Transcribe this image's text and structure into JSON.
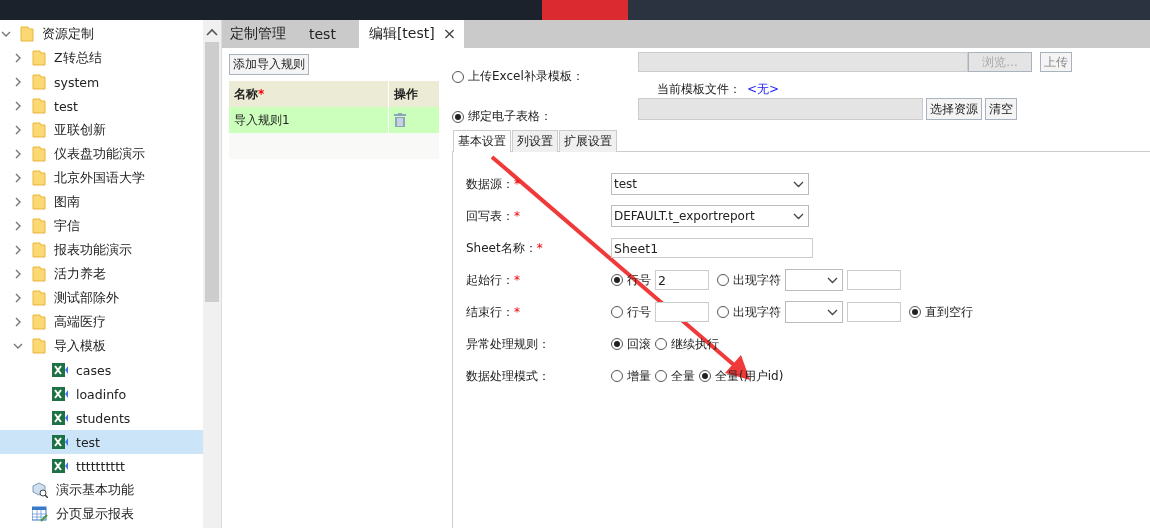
{
  "tree": [
    {
      "label": "资源定制",
      "kind": "folder",
      "expanded": true,
      "selected": false,
      "children": [
        {
          "label": "Z转总结",
          "kind": "folder",
          "expanded": false,
          "selected": false
        },
        {
          "label": "system",
          "kind": "folder",
          "expanded": false,
          "selected": false
        },
        {
          "label": "test",
          "kind": "folder",
          "expanded": false,
          "selected": false
        },
        {
          "label": "亚联创新",
          "kind": "folder",
          "expanded": false,
          "selected": false
        },
        {
          "label": "仪表盘功能演示",
          "kind": "folder",
          "expanded": false,
          "selected": false
        },
        {
          "label": "北京外国语大学",
          "kind": "folder",
          "expanded": false,
          "selected": false
        },
        {
          "label": "图南",
          "kind": "folder",
          "expanded": false,
          "selected": false
        },
        {
          "label": "宇信",
          "kind": "folder",
          "expanded": false,
          "selected": false
        },
        {
          "label": "报表功能演示",
          "kind": "folder",
          "expanded": false,
          "selected": false
        },
        {
          "label": "活力养老",
          "kind": "folder",
          "expanded": false,
          "selected": false
        },
        {
          "label": "测试部除外",
          "kind": "folder",
          "expanded": false,
          "selected": false
        },
        {
          "label": "高端医疗",
          "kind": "folder",
          "expanded": false,
          "selected": false
        },
        {
          "label": "导入模板",
          "kind": "folder",
          "expanded": true,
          "selected": false,
          "children": [
            {
              "label": "cases",
              "kind": "excel",
              "selected": false
            },
            {
              "label": "loadinfo",
              "kind": "excel",
              "selected": false
            },
            {
              "label": "students",
              "kind": "excel",
              "selected": false
            },
            {
              "label": "test",
              "kind": "excel",
              "selected": true
            },
            {
              "label": "tttttttttt",
              "kind": "excel",
              "selected": false
            }
          ]
        },
        {
          "label": "演示基本功能",
          "kind": "analysis",
          "selected": false
        },
        {
          "label": "分页显示报表",
          "kind": "report",
          "selected": false
        }
      ]
    }
  ],
  "tabs": [
    {
      "label": "定制管理",
      "selected": false
    },
    {
      "label": "test",
      "selected": false
    },
    {
      "label": "编辑[test]",
      "selected": true,
      "close": "×"
    }
  ],
  "rules": {
    "add_button": "添加导入规则",
    "columns": [
      {
        "label": "名称",
        "mark": "*"
      },
      {
        "label": "操作"
      }
    ],
    "rows": [
      {
        "name": "导入规则1",
        "selected": true
      }
    ]
  },
  "source": {
    "upload": {
      "label": "上传Excel补录模板：",
      "selected": false,
      "browse": "浏览...",
      "button": "上传",
      "current_label": "当前模板文件：",
      "current_file": "<无>"
    },
    "bind": {
      "label": "绑定电子表格：",
      "selected": true,
      "buttons": [
        "选择资源",
        "清空"
      ]
    }
  },
  "subtabs": [
    {
      "label": "基本设置",
      "selected": true
    },
    {
      "label": "列设置",
      "selected": false
    },
    {
      "label": "扩展设置",
      "selected": false
    }
  ],
  "form": [
    {
      "label": "数据源：",
      "mark": "*",
      "kind": "select",
      "value": "test"
    },
    {
      "label": "回写表：",
      "mark": "*",
      "kind": "select",
      "value": "DEFAULT.t_exportreport"
    },
    {
      "label": "Sheet名称：",
      "mark": "*",
      "kind": "text",
      "value": "Sheet1"
    },
    {
      "label": "起始行：",
      "mark": "*",
      "kind": "range",
      "options": [
        {
          "label": "行号",
          "selected": true,
          "value": "2"
        },
        {
          "label": "出现字符",
          "selected": false
        }
      ]
    },
    {
      "label": "结束行：",
      "mark": "*",
      "kind": "range",
      "options": [
        {
          "label": "行号",
          "selected": false
        },
        {
          "label": "出现字符",
          "selected": false
        }
      ],
      "until_blank": {
        "label": "直到空行",
        "selected": true
      }
    },
    {
      "label": "异常处理规则：",
      "kind": "radios",
      "options": [
        {
          "label": "回滚",
          "selected": true
        },
        {
          "label": "继续执行",
          "selected": false
        }
      ]
    },
    {
      "label": "数据处理模式：",
      "kind": "radios",
      "options": [
        {
          "label": "增量",
          "selected": false
        },
        {
          "label": "全量",
          "selected": false
        },
        {
          "label": "全量(用户id)",
          "selected": true
        }
      ]
    }
  ]
}
